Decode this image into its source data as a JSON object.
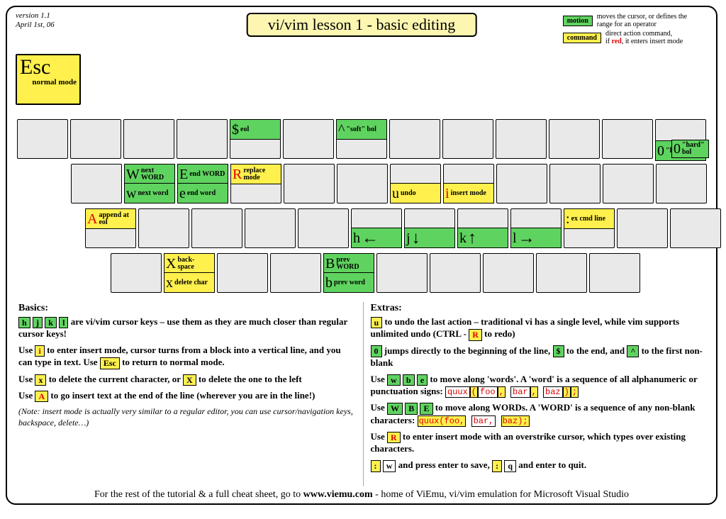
{
  "meta": {
    "version": "version 1.1",
    "date": "April 1st, 06"
  },
  "title": "vi/vim lesson 1 - basic editing",
  "legend": {
    "motion": {
      "chip": "motion",
      "text": "moves the cursor, or defines the range for an operator"
    },
    "command": {
      "chip": "command",
      "text_a": "direct action command,",
      "text_b": "if ",
      "text_red": "red",
      "text_c": ", it enters insert mode"
    }
  },
  "esc": {
    "big": "Esc",
    "small": "normal mode"
  },
  "row_num": {
    "k4": {
      "g": "$",
      "l": "eol",
      "bg": "g"
    },
    "k6": {
      "g": "^",
      "l": "\"soft\" bol",
      "bg": "g"
    },
    "k0": {
      "g": "0",
      "l": "\"hard\" bol",
      "bg": "g"
    }
  },
  "row_q": {
    "W": {
      "g": "W",
      "l": "next WORD",
      "bg": "g"
    },
    "w": {
      "g": "w",
      "l": "next word",
      "bg": "g"
    },
    "E": {
      "g": "E",
      "l": "end WORD",
      "bg": "g"
    },
    "e": {
      "g": "e",
      "l": "end word",
      "bg": "g"
    },
    "R": {
      "g": "R",
      "l": "replace mode",
      "bg": "y",
      "red": true
    },
    "u": {
      "g": "u",
      "l": "undo",
      "bg": "y"
    },
    "i": {
      "g": "i",
      "l": "insert mode",
      "bg": "y",
      "red": true
    }
  },
  "row_a": {
    "A": {
      "g": "A",
      "l": "append at eol",
      "bg": "y",
      "red": true
    },
    "h": {
      "g": "h",
      "arrow": "←",
      "bg": "g"
    },
    "j": {
      "g": "j",
      "arrow": "↓",
      "bg": "g"
    },
    "k": {
      "g": "k",
      "arrow": "↑",
      "bg": "g"
    },
    "l": {
      "g": "l",
      "arrow": "→",
      "bg": "g"
    },
    "colon": {
      "g": ":",
      "l": "ex cmd line",
      "bg": "y"
    }
  },
  "row_z": {
    "X": {
      "g": "X",
      "l": "back- space",
      "bg": "y"
    },
    "x": {
      "g": "x",
      "l": "delete char",
      "bg": "y"
    },
    "B": {
      "g": "B",
      "l": "prev WORD",
      "bg": "g"
    },
    "b": {
      "g": "b",
      "l": "prev word",
      "bg": "g"
    }
  },
  "basics": {
    "h": "Basics:",
    "p1a": "are vi/vim cursor keys – use them as they are  much closer than regular cursor keys!",
    "p2a": "Use ",
    "p2b": " to enter insert mode, cursor turns from a block into a vertical line, and you can type in text. Use ",
    "p2c": "  to return to normal mode.",
    "p3a": "Use ",
    "p3b": " to delete the current character, or ",
    "p3c": "  to delete the one to the left",
    "p4a": "Use ",
    "p4b": " to go insert text at the end of the line (wherever you are in the line!)",
    "note": "(Note: insert mode is actually very similar to a regular editor, you can use cursor/navigation keys, backspace,  delete…)"
  },
  "extras": {
    "h": "Extras:",
    "p1a": " to undo the last action – traditional vi has a single level, while vim supports unlimited undo (CTRL - ",
    "p1b": " to redo)",
    "p2a": " jumps directly to the beginning of the line, ",
    "p2b": " to the end, and ",
    "p2c": " to the first non-blank",
    "p3a": "Use ",
    "p3b": " to move along 'words'. A 'word' is a sequence of all alphanumeric or punctuation signs:   ",
    "code1_a": "quux",
    "code1_b": "(",
    "code1_c": "foo",
    "code1_d": ",",
    "code1_e": "bar",
    "code1_f": ",",
    "code1_g": "baz",
    "code1_h": ")",
    "code1_i": ";",
    "p4a": "Use ",
    "p4b": " to move along WORDs. A 'WORD' is a sequence of any non-blank characters:   ",
    "code2_a": "quux(foo,",
    "code2_b": "bar,",
    "code2_c": "baz);",
    "p5a": "Use ",
    "p5b": " to enter insert mode with an overstrike cursor, which types over existing characters.",
    "p6a": " and press enter to save, ",
    "p6b": " and enter to quit."
  },
  "footer_a": "For the rest of the tutorial & a full cheat sheet, go to ",
  "footer_b": "www.viemu.com",
  "footer_c": " - home of ViEmu, vi/vim emulation for Microsoft Visual Studio",
  "k": {
    "h": "h",
    "j": "j",
    "k": "k",
    "l": "l",
    "i": "i",
    "Esc": "Esc",
    "x": "x",
    "X": "X",
    "A": "A",
    "u": "u",
    "R": "R",
    "0": "0",
    "$": "$",
    "caret": "^",
    "w": "w",
    "b": "b",
    "e": "e",
    "W": "W",
    "B": "B",
    "E": "E",
    "colon": ":",
    "q": "q"
  }
}
